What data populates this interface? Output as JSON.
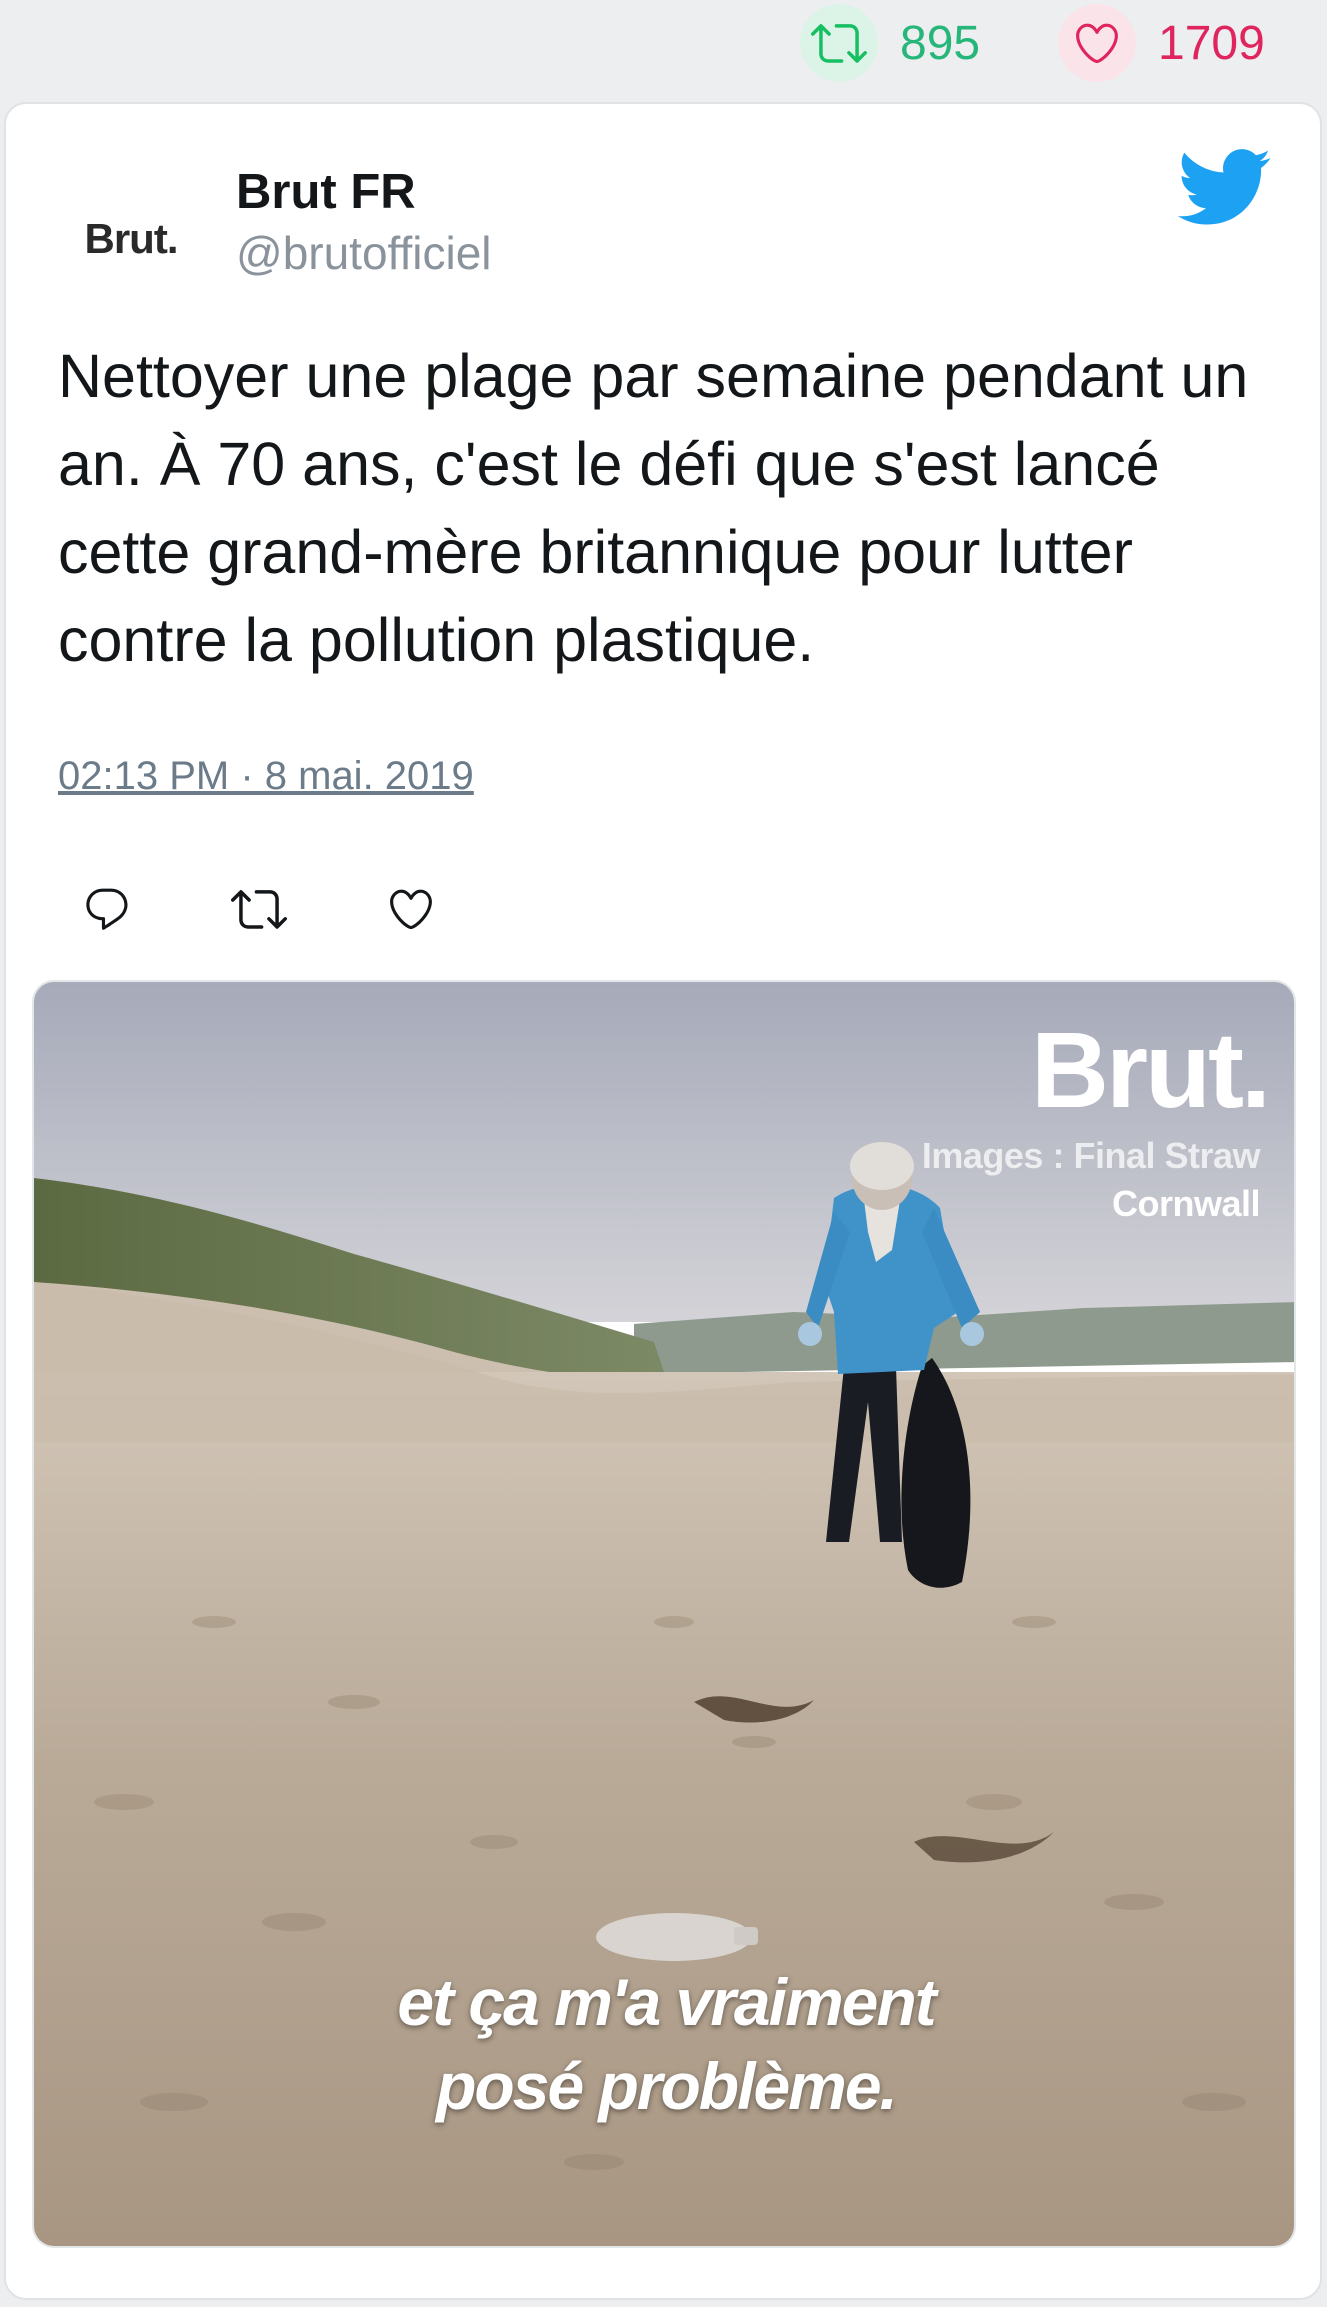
{
  "stats": {
    "retweet_count": "895",
    "like_count": "1709",
    "retweet_icon": "retweet-icon",
    "like_icon": "heart-icon"
  },
  "author": {
    "avatar_text": "Brut.",
    "name": "Brut FR",
    "handle": "@brutofficiel"
  },
  "tweet": {
    "text": "Nettoyer une plage par semaine pendant un an. À 70 ans, c'est le défi que s'est lancé cette grand-mère britannique pour lutter contre la pollution plastique.",
    "timestamp": "02:13 PM · 8 mai. 2019"
  },
  "actions": [
    "reply-icon",
    "retweet-icon",
    "heart-icon"
  ],
  "media": {
    "watermark": "Brut.",
    "credit_line1": "Images : Final Straw",
    "credit_line2": "Cornwall",
    "subtitle_line1": "et ça m'a vraiment",
    "subtitle_line2": "posé problème."
  },
  "colors": {
    "retweet_green": "#17bf63",
    "like_red": "#e0245e",
    "twitter_blue": "#1da1f2",
    "text_primary": "#14171a",
    "text_secondary": "#8a939b"
  }
}
